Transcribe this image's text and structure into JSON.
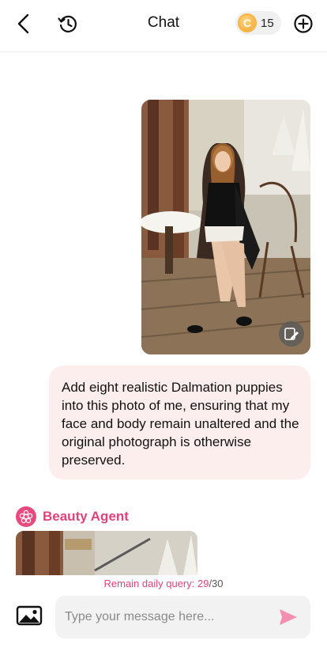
{
  "header": {
    "title": "Chat",
    "credits": {
      "coin_letter": "C",
      "count": "15"
    },
    "icons": {
      "back": "chevron-left-icon",
      "history": "history-icon",
      "new_chat": "plus-circle-icon"
    }
  },
  "messages": {
    "user_photo": {
      "description": "woman sitting at outdoor cafe terrace",
      "edit_icon": "edit-image-icon"
    },
    "user_text": "Add eight realistic Dalmation puppies into this photo of me, ensuring that my face and body remain unaltered and the original photograph is otherwise preserved.",
    "agent": {
      "name": "Beauty Agent",
      "avatar_icon": "flower-icon"
    }
  },
  "quota": {
    "label": "Remain daily query: ",
    "remaining": "29",
    "total": "/30"
  },
  "composer": {
    "placeholder": "Type your message here...",
    "image_icon": "image-icon",
    "send_icon": "send-icon"
  },
  "colors": {
    "accent": "#e0427a",
    "bubble": "#fdeeee",
    "coin": "#f0a12a",
    "send": "#f48fb1"
  }
}
